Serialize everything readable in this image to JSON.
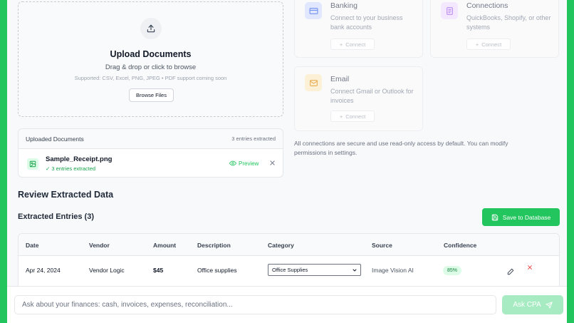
{
  "upload": {
    "title": "Upload Documents",
    "subtitle": "Drag & drop or click to browse",
    "supported": "Supported: CSV, Excel, PNG, JPEG • PDF support coming soon",
    "browse_label": "Browse Files"
  },
  "uploaded": {
    "title": "Uploaded Documents",
    "count": "3 entries extracted",
    "file_name": "Sample_Receipt.png",
    "file_status": "✓ 3 entries extracted",
    "preview_label": "Preview"
  },
  "connections": {
    "banking": {
      "name": "Banking",
      "desc": "Connect to your business bank accounts",
      "button": "Connect"
    },
    "other": {
      "name": "Connections",
      "desc": "QuickBooks, Shopify, or other systems",
      "button": "Connect"
    },
    "email": {
      "name": "Email",
      "desc": "Connect Gmail or Outlook for invoices",
      "button": "Connect"
    },
    "note": "All connections are secure and use read-only access by default. You can modify permissions in settings."
  },
  "review": {
    "title": "Review Extracted Data",
    "entries_title": "Extracted Entries (3)",
    "save_label": "Save to Database"
  },
  "table": {
    "headers": [
      "Date",
      "Vendor",
      "Amount",
      "Description",
      "Category",
      "Source",
      "Confidence"
    ],
    "rows": [
      {
        "date": "Apr 24, 2024",
        "vendor": "Vendor Logic",
        "amount": "$45",
        "description": "Office supplies",
        "category": "Office Supplies",
        "source": "Image Vision AI",
        "confidence": "85%"
      }
    ]
  },
  "ask": {
    "placeholder": "Ask about your finances: cash, invoices, expenses, reconciliation...",
    "button": "Ask CPA"
  },
  "colors": {
    "accent": "#22c55e",
    "danger": "#ef4444"
  }
}
